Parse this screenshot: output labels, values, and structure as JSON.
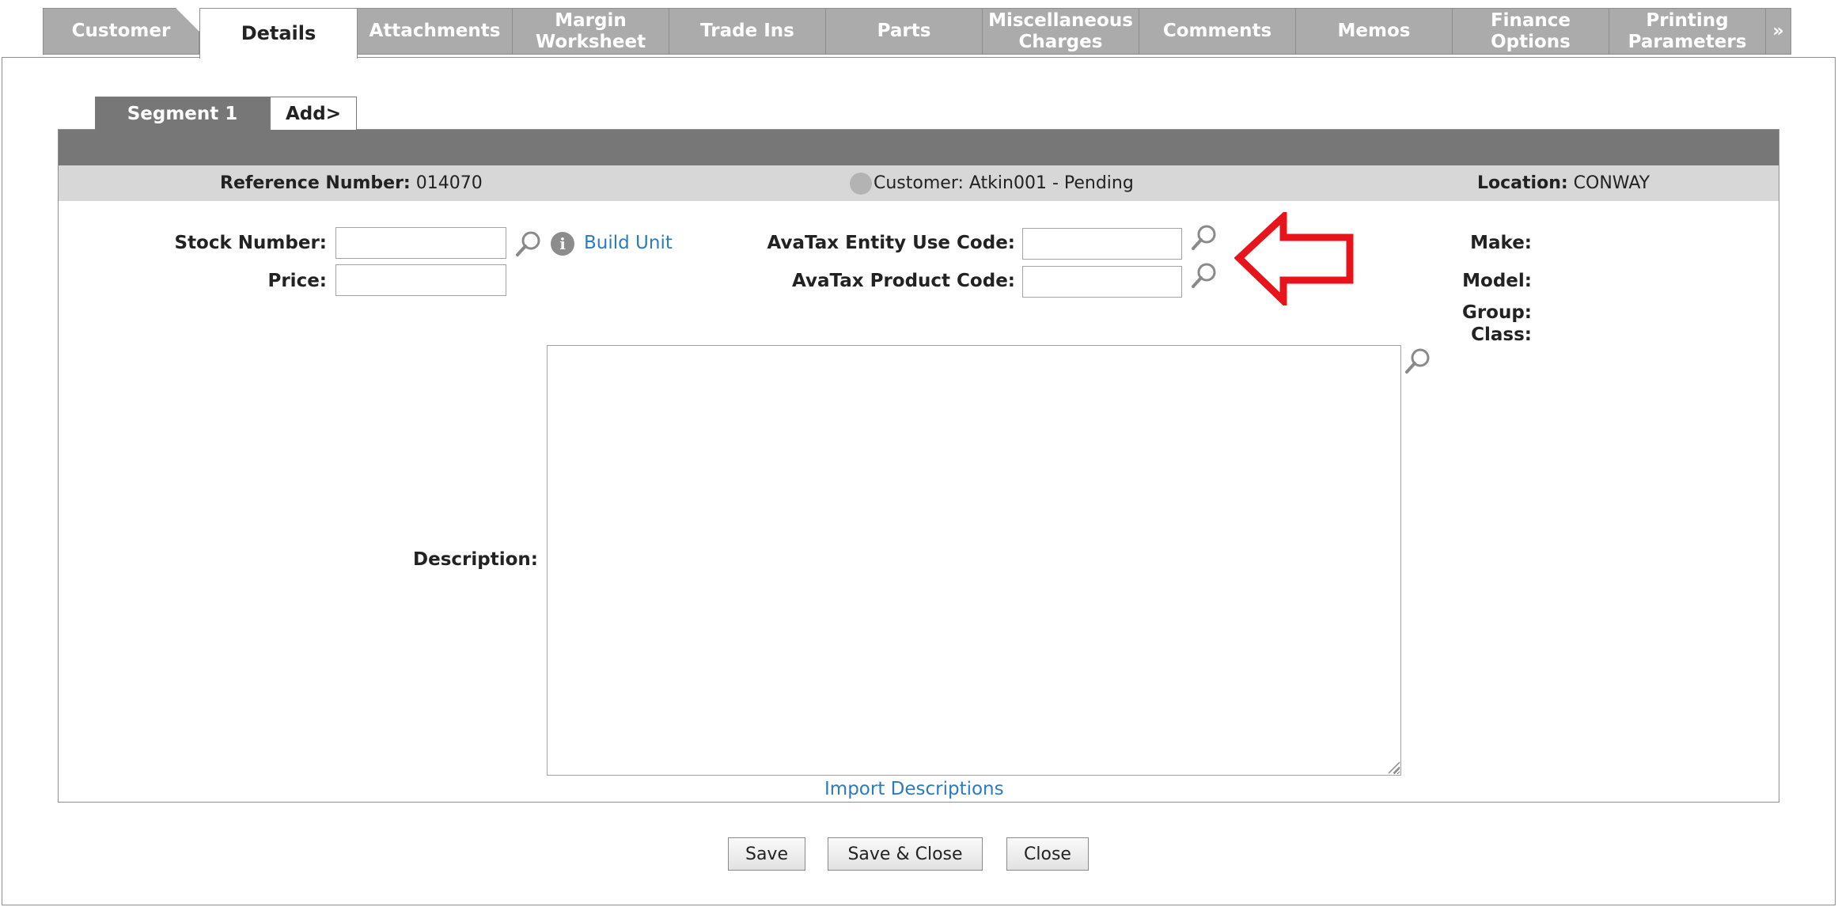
{
  "tabs": [
    {
      "label": "Customer",
      "active": false
    },
    {
      "label": "Details",
      "active": true
    },
    {
      "label": "Attachments",
      "active": false
    },
    {
      "label": "Margin\nWorksheet",
      "active": false
    },
    {
      "label": "Trade Ins",
      "active": false
    },
    {
      "label": "Parts",
      "active": false
    },
    {
      "label": "Miscellaneous\nCharges",
      "active": false
    },
    {
      "label": "Comments",
      "active": false
    },
    {
      "label": "Memos",
      "active": false
    },
    {
      "label": "Finance\nOptions",
      "active": false
    },
    {
      "label": "Printing\nParameters",
      "active": false
    }
  ],
  "tab_more_label": "»",
  "segments": {
    "active_label": "Segment 1",
    "add_label": "Add>"
  },
  "info": {
    "reference_label": "Reference Number:",
    "reference_value": " 014070",
    "customer_text": "Customer: Atkin001  -  Pending",
    "location_label": "Location:",
    "location_value": " CONWAY"
  },
  "form": {
    "stock_number_label": "Stock Number:",
    "stock_number_value": "",
    "price_label": "Price:",
    "price_value": "",
    "build_unit_link": "Build Unit",
    "entity_use_code_label": "AvaTax Entity Use Code:",
    "entity_use_code_value": "",
    "product_code_label": "AvaTax Product Code:",
    "product_code_value": "",
    "make_label": "Make:",
    "model_label": "Model:",
    "group_label": "Group:",
    "class_label": "Class:",
    "description_label": "Description:",
    "description_value": "",
    "import_descriptions_link": "Import Descriptions"
  },
  "buttons": {
    "save": "Save",
    "save_close": "Save & Close",
    "close": "Close"
  },
  "colors": {
    "tab_inactive": "#ababab",
    "header_dark": "#777777",
    "info_bar": "#d7d7d7",
    "link": "#2c7bbf",
    "annotation_arrow": "#e8141b"
  },
  "icons": {
    "lookup": "magnifier-icon",
    "info": "info-icon",
    "annotation": "red-arrow-left"
  }
}
